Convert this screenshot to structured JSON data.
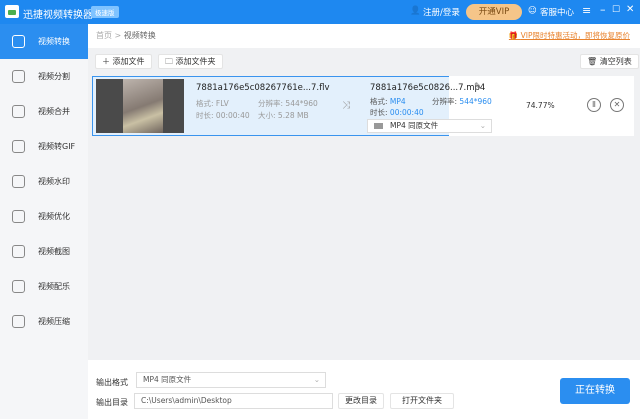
{
  "app": {
    "title": "迅捷视频转换器",
    "edition": "极速版",
    "login": "注册/登录",
    "vip": "开通VIP",
    "service": "客服中心"
  },
  "sidebar": {
    "items": [
      {
        "label": "视频转换",
        "active": true
      },
      {
        "label": "视频分割"
      },
      {
        "label": "视频合并"
      },
      {
        "label": "视频转GIF"
      },
      {
        "label": "视频水印"
      },
      {
        "label": "视频优化"
      },
      {
        "label": "视频截图"
      },
      {
        "label": "视频配乐"
      },
      {
        "label": "视频压缩"
      }
    ]
  },
  "breadcrumb": {
    "home": "首页",
    "sep": ">",
    "current": "视频转换"
  },
  "promo": "VIP限时特惠活动，即将恢复原价",
  "toolbar": {
    "add_file": "添加文件",
    "add_folder": "添加文件夹",
    "clear": "清空列表"
  },
  "file": {
    "src_name": "7881a176e5c08267761e...7.flv",
    "fmt_label": "格式:",
    "fmt": "FLV",
    "res_label": "分辨率:",
    "res": "544*960",
    "dur_label": "时长:",
    "dur": "00:00:40",
    "size_label": "大小:",
    "size": "5.28 MB",
    "out_name": "7881a176e5c0826...7.mp4",
    "out_fmt": "MP4",
    "out_res": "544*960",
    "out_dur": "00:00:40",
    "preset": "MP4  同原文件",
    "progress_text": "74.77%",
    "progress": 74.77
  },
  "bottom": {
    "format_label": "输出格式",
    "format_value": "MP4  同原文件",
    "dir_label": "输出目录",
    "dir_value": "C:\\Users\\admin\\Desktop",
    "change_dir": "更改目录",
    "open_folder": "打开文件夹",
    "convert": "正在转换"
  },
  "colors": {
    "accent": "#1e88f0",
    "vip": "#f5c589",
    "promo": "#e8822c"
  }
}
